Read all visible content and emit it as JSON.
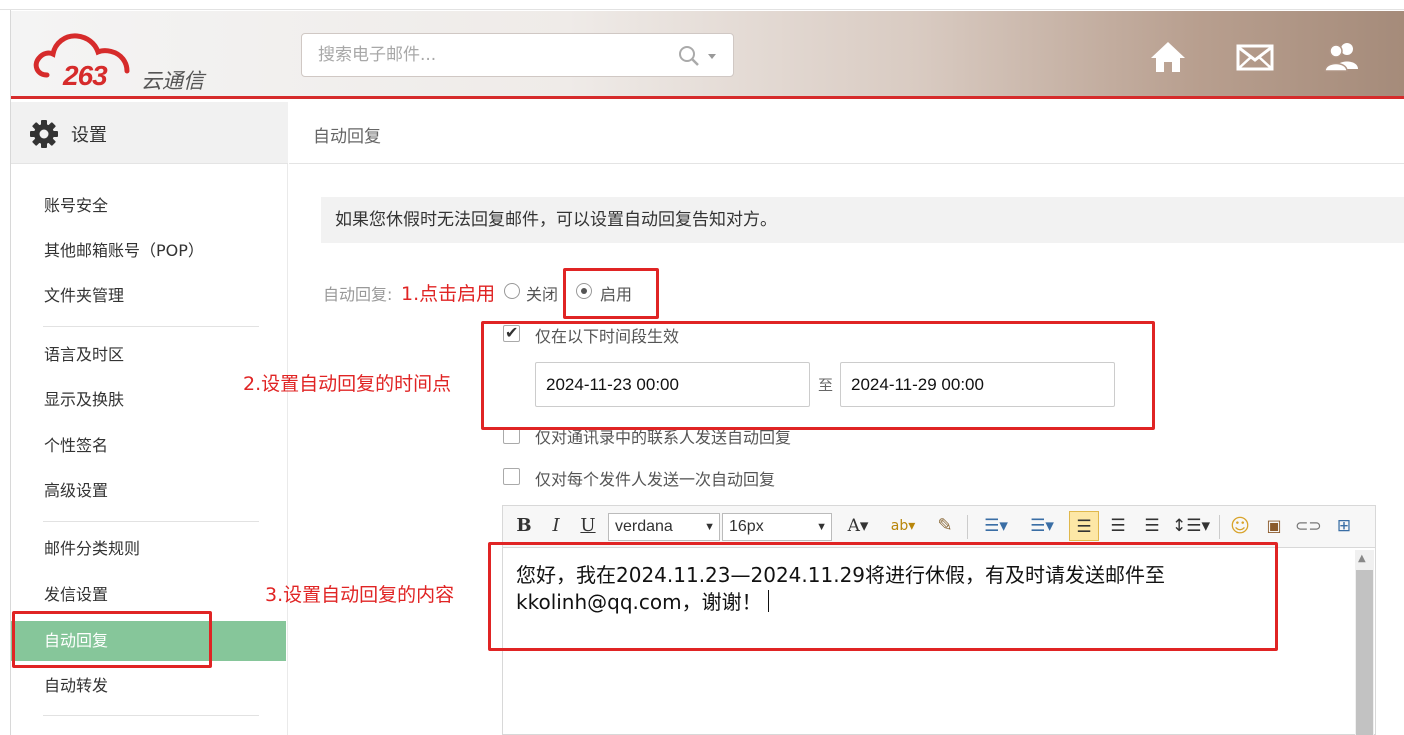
{
  "header": {
    "logo_number": "263",
    "logo_text": "云通信",
    "search_placeholder": "搜索电子邮件...",
    "icons": [
      "home-icon",
      "mail-icon",
      "contacts-icon"
    ]
  },
  "sidebar": {
    "title": "设置",
    "items": [
      {
        "label": "账号安全"
      },
      {
        "label": "其他邮箱账号（POP）"
      },
      {
        "label": "文件夹管理"
      },
      {
        "label": "语言及时区"
      },
      {
        "label": "显示及换肤"
      },
      {
        "label": "个性签名"
      },
      {
        "label": "高级设置"
      },
      {
        "label": "邮件分类规则"
      },
      {
        "label": "发信设置"
      },
      {
        "label": "自动回复",
        "active": true
      },
      {
        "label": "自动转发"
      }
    ]
  },
  "main": {
    "breadcrumb": "自动回复",
    "notice": "如果您休假时无法回复邮件，可以设置自动回复告知对方。",
    "auto_reply_label": "自动回复:",
    "radio_off": "关闭",
    "radio_on": "启用",
    "selected": "启用",
    "option_time_range": "仅在以下时间段生效",
    "start_time": "2024-11-23 00:00",
    "to_label": "至",
    "end_time": "2024-11-29 00:00",
    "option_contacts_only": "仅对通讯录中的联系人发送自动回复",
    "option_once_per_sender": "仅对每个发件人发送一次自动回复"
  },
  "editor": {
    "font_family": "verdana",
    "font_size": "16px",
    "content_line1": "您好，我在2024.11.23—2024.11.29将进行休假，有及时请发送邮件至",
    "content_line2": "kkolinh@qq.com，谢谢！"
  },
  "annotations": {
    "step1": "1.点击启用",
    "step2": "2.设置自动回复的时间点",
    "step3": "3.设置自动回复的内容",
    "color": "#e02424"
  },
  "colors": {
    "accent_red": "#d62b2b",
    "active_green": "#86c69a"
  }
}
